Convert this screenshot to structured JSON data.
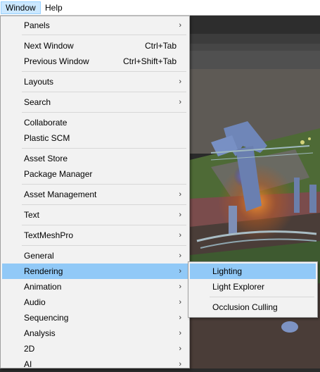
{
  "menubar": {
    "window": "Window",
    "help": "Help"
  },
  "window_menu": {
    "items": [
      {
        "label": "Panels",
        "submenu": true
      },
      {
        "label": "Next Window",
        "shortcut": "Ctrl+Tab"
      },
      {
        "label": "Previous Window",
        "shortcut": "Ctrl+Shift+Tab"
      },
      {
        "label": "Layouts",
        "submenu": true
      },
      {
        "label": "Search",
        "submenu": true
      },
      {
        "label": "Collaborate"
      },
      {
        "label": "Plastic SCM"
      },
      {
        "label": "Asset Store"
      },
      {
        "label": "Package Manager"
      },
      {
        "label": "Asset Management",
        "submenu": true
      },
      {
        "label": "Text",
        "submenu": true
      },
      {
        "label": "TextMeshPro",
        "submenu": true
      },
      {
        "label": "General",
        "submenu": true
      },
      {
        "label": "Rendering",
        "submenu": true,
        "highlighted": true
      },
      {
        "label": "Animation",
        "submenu": true
      },
      {
        "label": "Audio",
        "submenu": true
      },
      {
        "label": "Sequencing",
        "submenu": true
      },
      {
        "label": "Analysis",
        "submenu": true
      },
      {
        "label": "2D",
        "submenu": true
      },
      {
        "label": "AI",
        "submenu": true
      }
    ],
    "arrow_glyph": "›"
  },
  "rendering_submenu": {
    "items": [
      {
        "label": "Lighting",
        "highlighted": true
      },
      {
        "label": "Light Explorer"
      },
      {
        "label": "Occlusion Culling"
      }
    ]
  },
  "colors": {
    "menu_bg": "#f2f2f2",
    "highlight": "#91c9f7",
    "menubar_active": "#cce8ff"
  }
}
